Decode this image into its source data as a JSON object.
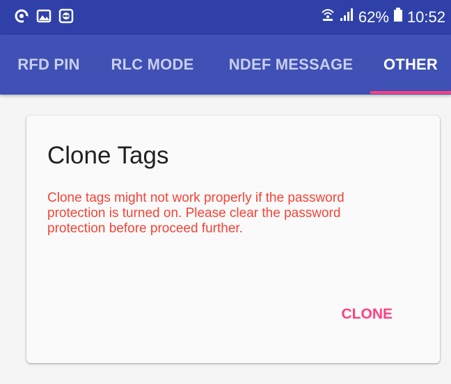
{
  "status_bar": {
    "left_icons": [
      "at-sign-notification-icon",
      "image-notification-icon",
      "teamviewer-icon"
    ],
    "battery_percent": "62%",
    "time": "10:52",
    "right_icons": [
      "wifi-icon",
      "signal-icon",
      "battery-icon"
    ]
  },
  "tabs": [
    {
      "label": "RFD PIN",
      "active": false
    },
    {
      "label": "RLC MODE",
      "active": false
    },
    {
      "label": "NDEF MESSAGE",
      "active": false
    },
    {
      "label": "OTHER",
      "active": true
    }
  ],
  "card": {
    "title": "Clone Tags",
    "warning_line1": "Clone tags might not work properly if the password",
    "warning_line2": "protection is turned on. Please clear the password",
    "warning_line3": "protection before proceed further.",
    "action_label": "CLONE"
  },
  "colors": {
    "status_bar": "#2f41a8",
    "tab_bar": "#3f51b5",
    "accent": "#ff4081",
    "warning_text": "#f44336"
  }
}
